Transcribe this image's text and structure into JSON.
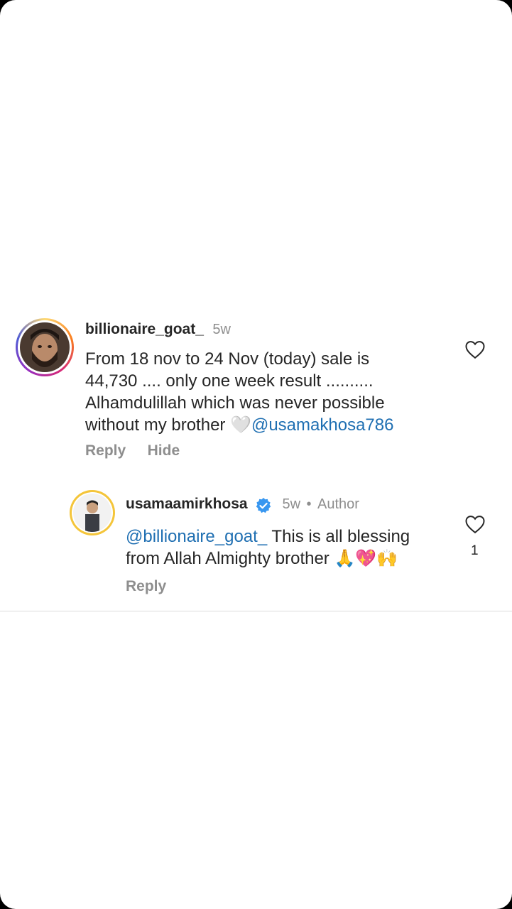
{
  "comments": [
    {
      "username": "billionaire_goat_",
      "time": "5w",
      "lines": [
        "From 18 nov to 24 Nov (today) sale is",
        "44,730 .... only one week result ..........",
        "Alhamdulillah which was never possible",
        "without my brother 🤍"
      ],
      "mention_end": "@usamakhosa786",
      "actions": [
        "Reply",
        "Hide"
      ]
    },
    {
      "username": "usamaamirkhosa",
      "time": "5w",
      "separator": "•",
      "author_tag": "Author",
      "mention_start": "@billionaire_goat_",
      "line1_rest": " This is all blessing",
      "line2": "from Allah Almighty brother 🙏💖🙌",
      "actions": [
        "Reply"
      ],
      "likes": "1"
    }
  ],
  "colors": {
    "mention": "#1f6fb2",
    "meta": "#8e8e8e",
    "verified": "#3897f0"
  },
  "icons": [
    "heart-outline-icon",
    "verified-badge-icon"
  ]
}
